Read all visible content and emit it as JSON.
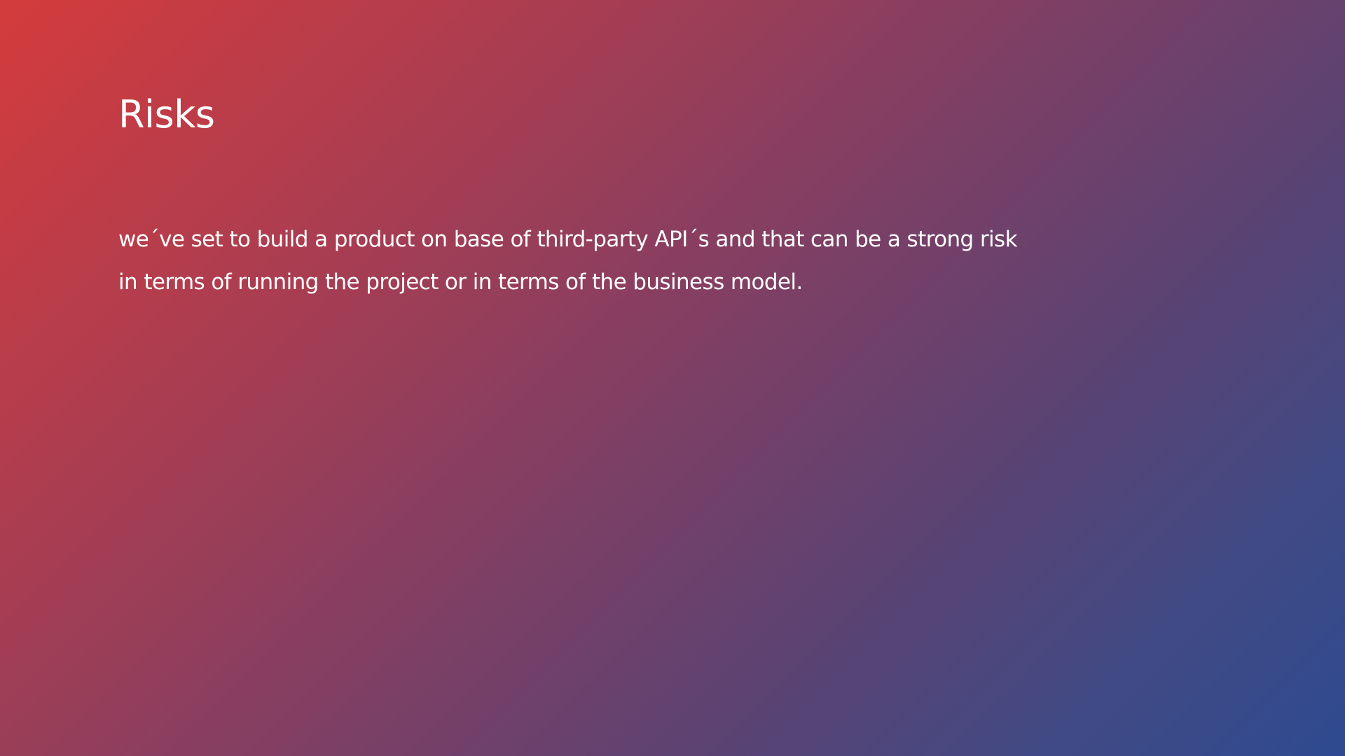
{
  "slide": {
    "title": "Risks",
    "body_line_1": "we´ve set to build a product on base of third-party API´s and that can be a strong risk",
    "body_line_2": "in terms of running the project or in terms of the business model."
  }
}
